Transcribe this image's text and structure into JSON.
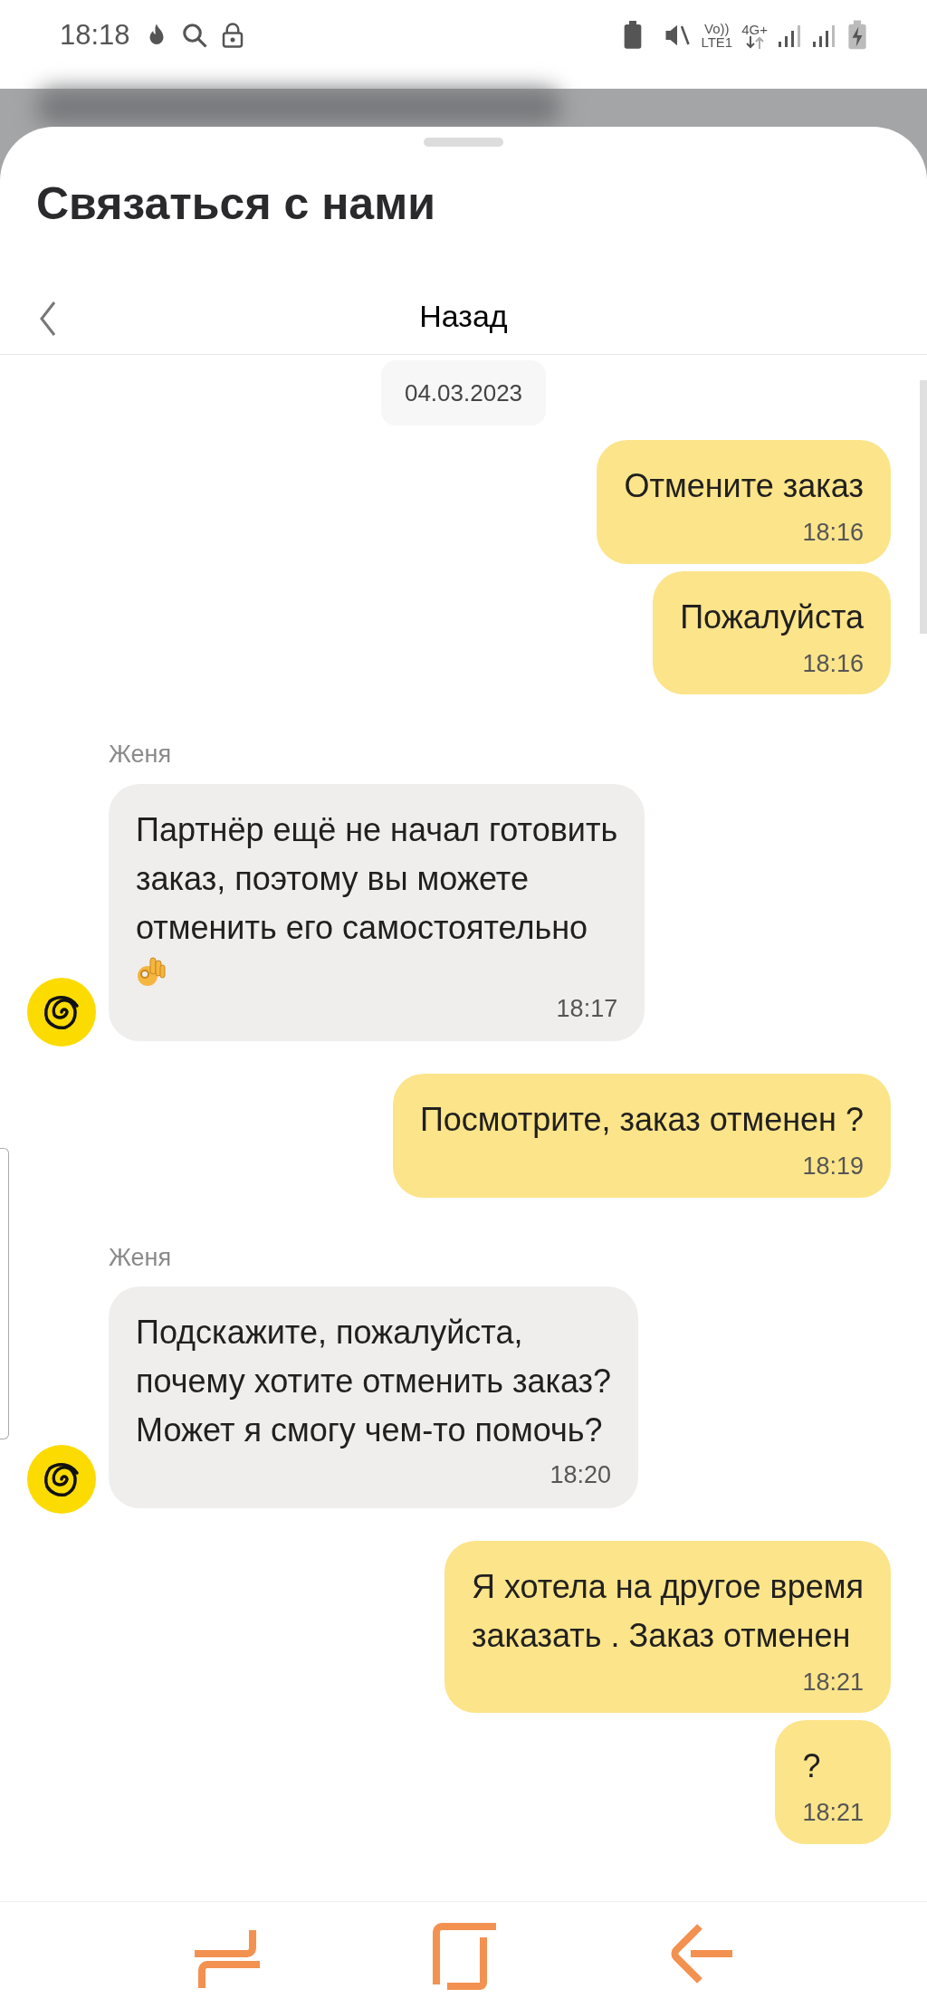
{
  "status_bar": {
    "time": "18:18",
    "volte": "Vo))",
    "lte": "LTE1",
    "network": "4G+"
  },
  "sheet": {
    "title": "Связаться с нами",
    "back_label": "Назад"
  },
  "date": "04.03.2023",
  "messages": [
    {
      "kind": "user",
      "lines": [
        "Отмените заказ"
      ],
      "time": "18:16"
    },
    {
      "kind": "user",
      "lines": [
        "Пожалуйста"
      ],
      "time": "18:16"
    },
    {
      "kind": "agent",
      "author": "Женя",
      "lines": [
        "Партнёр ещё не начал готовить",
        "заказ, поэтому вы можете",
        "отменить его самостоятельно"
      ],
      "ok_emoji": true,
      "time": "18:17"
    },
    {
      "kind": "user",
      "lines": [
        "Посмотрите, заказ отменен ?"
      ],
      "time": "18:19"
    },
    {
      "kind": "agent",
      "author": "Женя",
      "lines": [
        "Подскажите, пожалуйста,",
        "почему хотите отменить заказ?",
        "Может я смогу чем-то помочь?"
      ],
      "ok_emoji": false,
      "time": "18:20"
    },
    {
      "kind": "user",
      "lines": [
        "Я хотела на другое время",
        "заказать . Заказ отменен"
      ],
      "time": "18:21"
    },
    {
      "kind": "user",
      "lines": [
        "?"
      ],
      "time": "18:21"
    }
  ]
}
